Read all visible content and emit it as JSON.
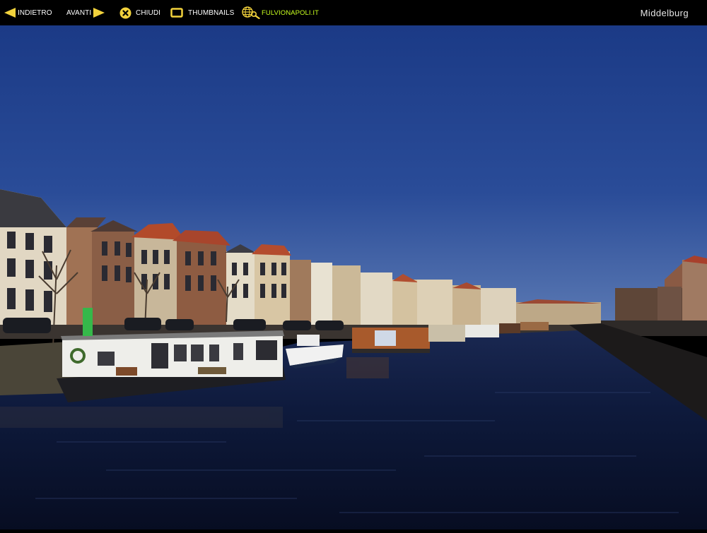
{
  "toolbar": {
    "back_label": "INDIETRO",
    "forward_label": "AVANTI",
    "close_label": "CHIUDI",
    "thumbnails_label": "THUMBNAILS",
    "site_label": "FULVIONAPOLI.IT"
  },
  "page_title": "Middelburg",
  "colors": {
    "toolbar_bg": "#000000",
    "accent_yellow": "#f2d23c",
    "site_link_green": "#c9ff1f",
    "sky": "#1f3f88",
    "water": "#0c1533"
  },
  "icons": {
    "back": "arrow-left-icon",
    "forward": "arrow-right-icon",
    "close": "close-circle-icon",
    "thumbnails": "thumbnails-icon",
    "site": "globe-search-icon"
  }
}
